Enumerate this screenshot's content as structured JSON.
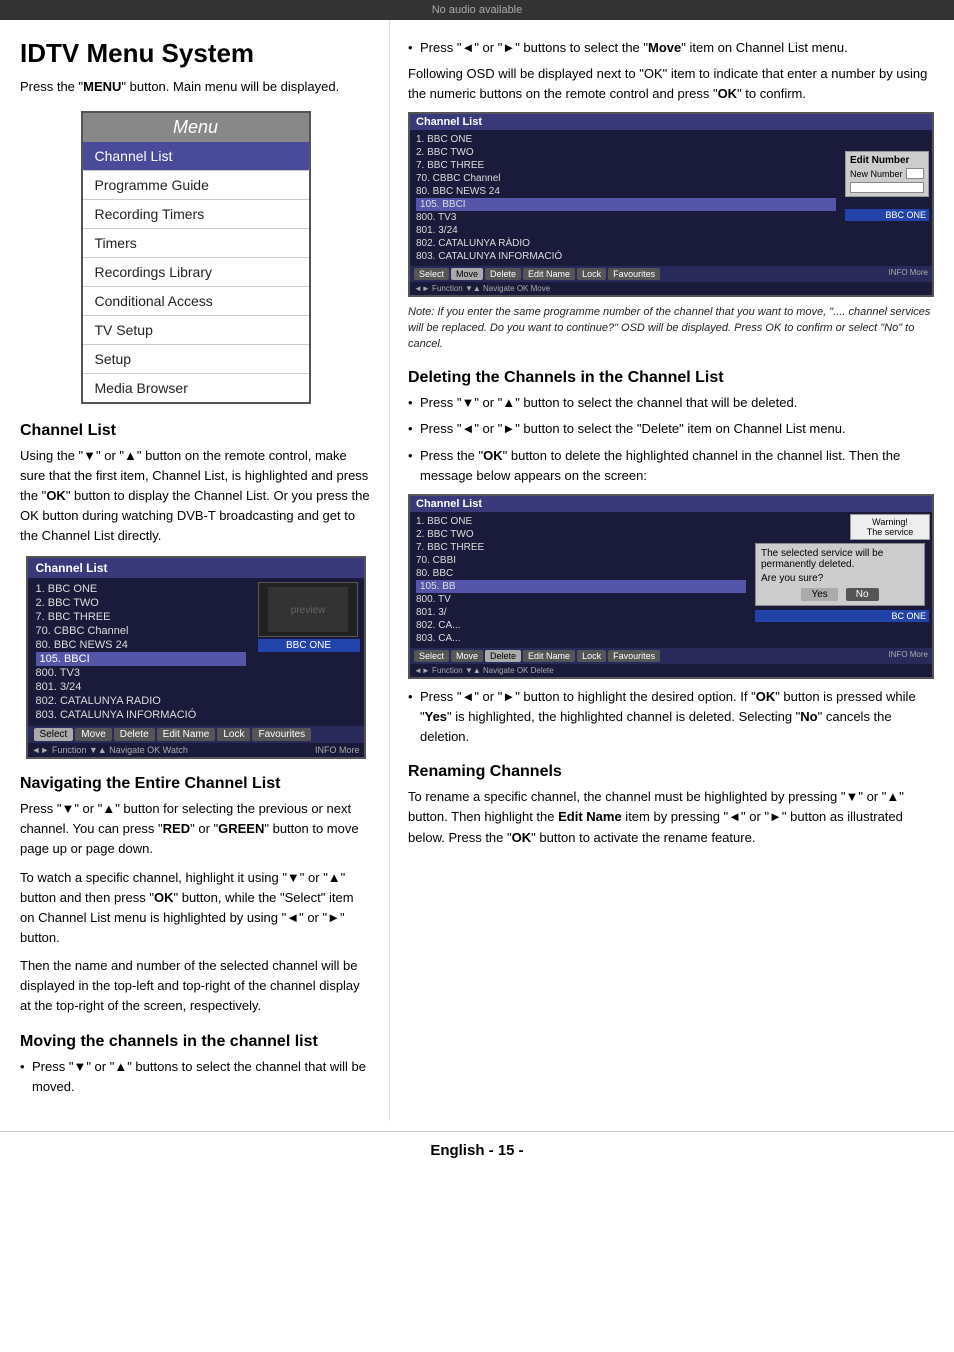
{
  "banner": {
    "text": "No audio available"
  },
  "left": {
    "title": "IDTV Menu System",
    "intro": "Press the \"MENU\" button. Main menu will be displayed.",
    "menu": {
      "title": "Menu",
      "items": [
        {
          "label": "Channel List",
          "highlighted": true
        },
        {
          "label": "Programme Guide",
          "highlighted": false
        },
        {
          "label": "Recording Timers",
          "highlighted": false
        },
        {
          "label": "Timers",
          "highlighted": false
        },
        {
          "label": "Recordings Library",
          "highlighted": false
        },
        {
          "label": "Conditional Access",
          "highlighted": false
        },
        {
          "label": "TV Setup",
          "highlighted": false
        },
        {
          "label": "Setup",
          "highlighted": false
        },
        {
          "label": "Media Browser",
          "highlighted": false
        }
      ]
    },
    "channel_list_section": {
      "heading": "Channel List",
      "body1": "Using the \"▼\" or \"▲\" button on the remote control, make sure that the first item, Channel List, is highlighted and press the \"OK\" button to display the Channel List. Or you press the OK button during watching DVB-T broadcasting and get to the Channel List directly.",
      "channels": [
        "1. BBC ONE",
        "2. BBC TWO",
        "7. BBC THREE",
        "70. CBBC Channel",
        "80. BBC NEWS 24",
        "105. BBCI",
        "800. TV3",
        "801. 3/24",
        "802. CATALUNYA RADIO",
        "803. CATALUNYA INFORMACIÓ"
      ],
      "tabs": [
        "Select",
        "Move",
        "Delete",
        "Edit Name",
        "Lock",
        "Favourites"
      ],
      "nav": "◄► Function ▼▲ Navigate OK Watch",
      "nav_right": "INFO More"
    },
    "navigating_section": {
      "heading": "Navigating the Entire Channel List",
      "body1": "Press \"▼\" or \"▲\" button for selecting the previous or next channel. You can press \"RED\" or \"GREEN\" button to move page up or page down.",
      "body2": "To watch a specific channel, highlight it using \"▼\" or \"▲\" button and then press \"OK\" button, while the \"Select\" item on Channel List menu is highlighted by using \"◄\" or \"►\" button.",
      "body3": "Then the name and number of the selected channel will be displayed in the top-left and top-right of the channel display at the top-right of the screen, respectively."
    },
    "moving_section": {
      "heading": "Moving the channels in the channel list",
      "bullet1": "Press \"▼\" or \"▲\" buttons to select the channel that will be moved."
    }
  },
  "right": {
    "move_bullet2": "Press \"◄\" or \"►\" buttons to select the \"Move\" item on Channel List menu.",
    "move_body": "Following OSD will be displayed next to \"OK\" item to indicate that enter a number by using the numeric buttons on the remote control and press \"OK\" to confirm.",
    "channels_move": [
      "1. BBC ONE",
      "2. BBC TWO",
      "7. BBC THREE",
      "70. CBBC Channel",
      "80. BBC NEWS 24",
      "105. BBCI",
      "800. TV3",
      "801. 3/24",
      "802. CATALUNYA RÀDIO",
      "803. CATALUNYA INFORMACIÓ"
    ],
    "overlay_edit_title": "Edit Number",
    "overlay_new_title": "New Number",
    "bbc_label": "BBC ONE",
    "tabs_move": [
      "Select",
      "Move",
      "Delete",
      "Edit Name",
      "Lock",
      "Favourites"
    ],
    "nav_move": "◄► Function ▼▲ Navigate OK Move",
    "nav_move_right": "INFO More",
    "note": "Note: If you enter the same programme number of the channel that you want to move, \".... channel services will be replaced. Do you want to continue?\" OSD will be displayed. Press OK to confirm or select \"No\" to cancel.",
    "deleting_section": {
      "heading": "Deleting the Channels in the Channel List",
      "bullet1": "Press \"▼\" or \"▲\" button to select the channel that will be deleted.",
      "bullet2": "Press \"◄\" or \"►\" button to select the \"Delete\" item on Channel List menu.",
      "bullet3": "Press the \"OK\" button to delete the highlighted channel in the channel list. Then the message below appears on the screen:"
    },
    "channels_del": [
      "1. BBC ONE",
      "2. BBC TWO",
      "7. BBC THREE",
      "70. CBBI",
      "80. BBC",
      "105. BE",
      "800. TV",
      "801. 3/",
      "802. CA...",
      "803. CA..."
    ],
    "dialog_text": "The selected service will be permanently deleted.",
    "dialog_text2": "Are you sure?",
    "dialog_yes": "Yes",
    "dialog_no": "No",
    "tabs_del": [
      "Select",
      "Move",
      "Delete",
      "Edit Name",
      "Lock",
      "Favourites"
    ],
    "nav_del": "◄► Function ▼▲ Navigate OK Delete",
    "nav_del_right": "INFO More",
    "del_bullet4": "Press \"◄\" or \"►\" button to highlight the desired option. If \"OK\" button is pressed while \"Yes\" is highlighted, the highlighted channel is deleted. Selecting \"No\" cancels the deletion.",
    "renaming_section": {
      "heading": "Renaming Channels",
      "body": "To rename a specific channel, the channel must be highlighted by pressing \"▼\" or \"▲\" button. Then highlight the Edit Name item by pressing \"◄\" or \"►\" button as illustrated below. Press the \"OK\" button to activate the rename feature."
    }
  },
  "footer": {
    "text": "English  - 15 -"
  }
}
